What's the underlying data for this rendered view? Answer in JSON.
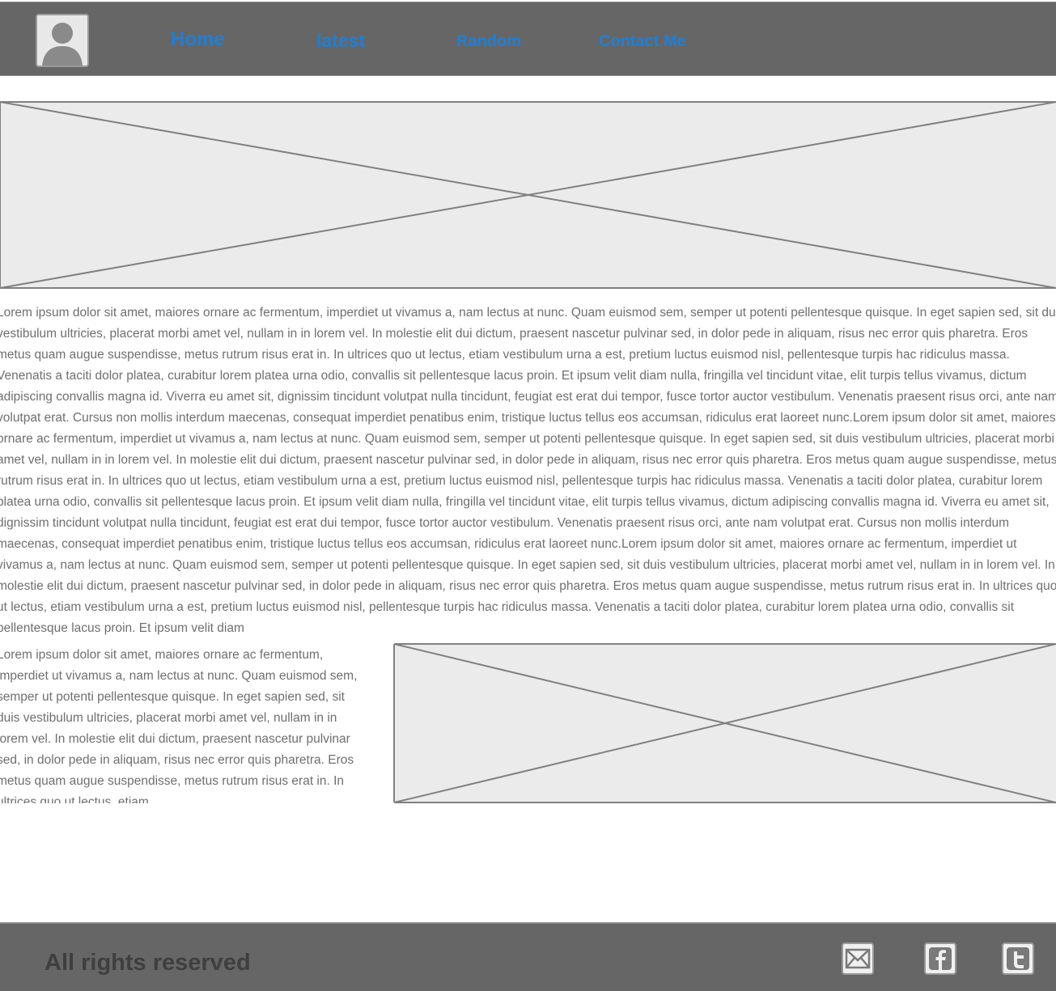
{
  "nav": {
    "links": [
      "Home",
      "latest",
      "Random",
      "Contact Me"
    ]
  },
  "colors": {
    "header_bg": "#666666",
    "nav_link": "#1e7fd6",
    "placeholder_fill": "#ebebeb",
    "placeholder_stroke": "#808080",
    "body_text": "#6f6f6f"
  },
  "icons": {
    "avatar": "user-avatar-icon",
    "email": "email-icon",
    "facebook": "facebook-icon",
    "twitter": "twitter-icon"
  },
  "content": {
    "paragraph_main": "Lorem ipsum dolor sit amet, maiores ornare ac fermentum, imperdiet ut vivamus a, nam lectus at nunc. Quam euismod sem, semper ut potenti pellentesque quisque. In eget sapien sed, sit duis vestibulum ultricies, placerat morbi amet vel, nullam in in lorem vel. In molestie elit dui dictum, praesent nascetur pulvinar sed, in dolor pede in aliquam, risus nec error quis pharetra. Eros metus quam augue suspendisse, metus rutrum risus erat in.  In ultrices quo ut lectus, etiam vestibulum urna a est, pretium luctus euismod nisl, pellentesque turpis hac ridiculus massa. Venenatis a taciti dolor platea, curabitur lorem platea urna odio, convallis sit pellentesque lacus proin. Et ipsum velit diam nulla, fringilla vel tincidunt vitae, elit turpis tellus vivamus, dictum adipiscing convallis magna id. Viverra eu amet sit, dignissim tincidunt volutpat nulla tincidunt, feugiat est erat dui tempor, fusce tortor auctor vestibulum. Venenatis praesent risus orci, ante nam volutpat erat. Cursus non mollis interdum maecenas, consequat imperdiet penatibus enim, tristique luctus tellus eos accumsan, ridiculus erat laoreet nunc.Lorem ipsum dolor sit amet, maiores ornare ac fermentum, imperdiet ut vivamus a, nam lectus at nunc. Quam euismod sem, semper ut potenti pellentesque quisque. In eget sapien sed, sit duis vestibulum ultricies, placerat morbi amet vel, nullam in in lorem vel. In molestie elit dui dictum, praesent nascetur pulvinar sed, in dolor pede in aliquam, risus nec error quis pharetra. Eros metus quam augue suspendisse, metus rutrum risus erat in.  In ultrices quo ut lectus, etiam vestibulum urna a est, pretium luctus euismod nisl, pellentesque turpis hac ridiculus massa. Venenatis a taciti dolor platea, curabitur lorem platea urna odio, convallis sit pellentesque lacus proin. Et ipsum velit diam nulla, fringilla vel tincidunt vitae, elit turpis tellus vivamus, dictum adipiscing convallis magna id. Viverra eu amet sit, dignissim tincidunt volutpat nulla tincidunt, feugiat est erat dui tempor, fusce tortor auctor vestibulum. Venenatis praesent risus orci, ante nam volutpat erat. Cursus non mollis interdum maecenas, consequat imperdiet penatibus enim, tristique luctus tellus eos accumsan, ridiculus erat laoreet nunc.Lorem ipsum dolor sit amet, maiores ornare ac fermentum, imperdiet ut vivamus a, nam lectus at nunc. Quam euismod sem, semper ut potenti pellentesque quisque. In eget sapien sed, sit duis vestibulum ultricies, placerat morbi amet vel, nullam in in lorem vel. In molestie elit dui dictum, praesent nascetur pulvinar sed, in dolor pede in aliquam, risus nec error quis pharetra. Eros metus quam augue suspendisse, metus rutrum risus erat in.  In ultrices quo ut lectus, etiam vestibulum urna a est, pretium luctus euismod nisl, pellentesque turpis hac ridiculus massa. Venenatis a taciti dolor platea, curabitur lorem platea urna odio, convallis sit pellentesque lacus proin. Et ipsum velit diam",
    "paragraph_side": "Lorem ipsum dolor sit amet, maiores ornare ac fermentum, imperdiet ut vivamus a, nam lectus at nunc. Quam euismod sem, semper ut potenti pellentesque quisque. In eget sapien sed, sit duis vestibulum ultricies, placerat morbi amet vel, nullam in in lorem vel. In molestie elit dui dictum, praesent nascetur pulvinar sed, in dolor pede in aliquam, risus nec error quis pharetra. Eros metus quam augue suspendisse, metus rutrum risus erat in.  In ultrices quo ut lectus, etiam"
  },
  "footer": {
    "text": "All rights reserved"
  }
}
